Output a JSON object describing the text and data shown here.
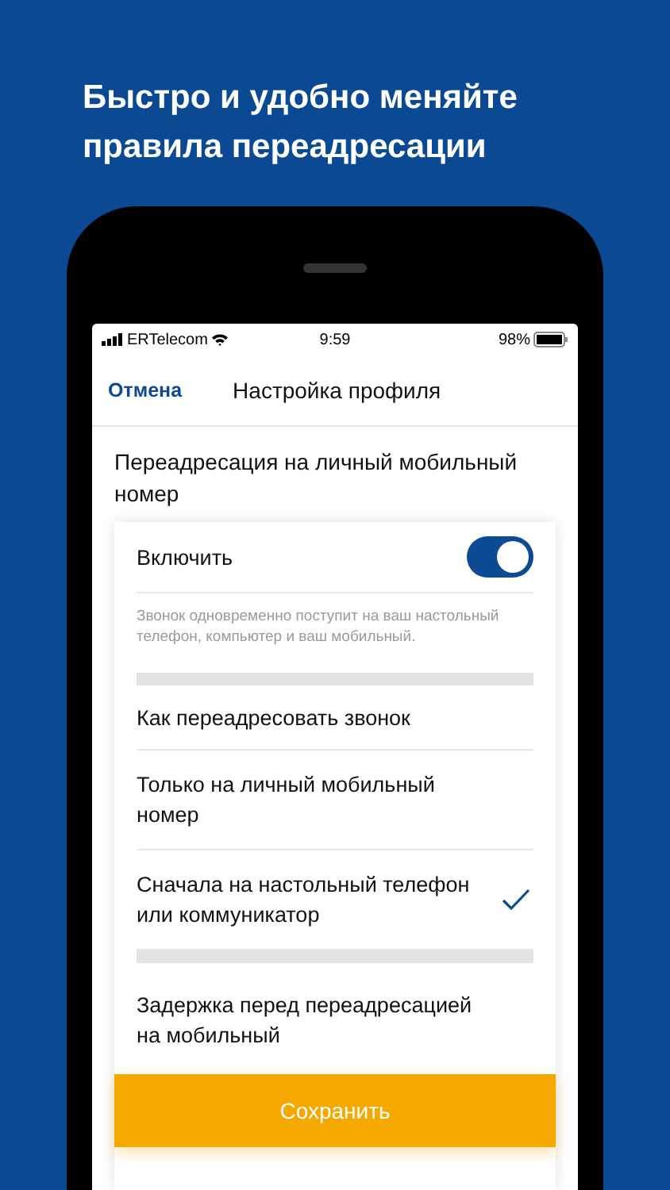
{
  "headline": "Быстро и удобно меняйте правила переадресации",
  "status_bar": {
    "carrier": "ERTelecom",
    "time": "9:59",
    "battery": "98%"
  },
  "nav": {
    "cancel": "Отмена",
    "title": "Настройка профиля"
  },
  "section_title": "Переадресация на личный мобильный номер",
  "enable": {
    "label": "Включить",
    "on": true
  },
  "hint": "Звонок одновременно поступит на ваш настольный телефон, компьютер и ваш мобильный.",
  "routing": {
    "title": "Как переадресовать звонок",
    "options": [
      {
        "label": "Только на личный мобильный номер",
        "selected": false
      },
      {
        "label": "Сначала на настольный телефон или коммуникатор",
        "selected": true
      }
    ]
  },
  "delay": {
    "title": "Задержка перед переадресацией на мобильный"
  },
  "save_button": "Сохранить"
}
